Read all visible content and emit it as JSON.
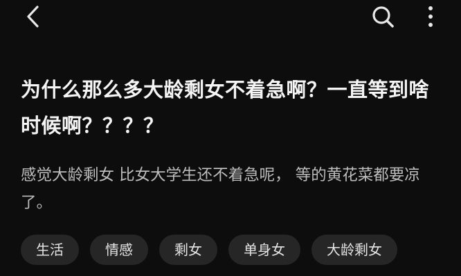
{
  "header": {
    "back_icon": "chevron-left-icon",
    "search_icon": "search-icon",
    "more_icon": "more-vertical-icon"
  },
  "question": {
    "title": "为什么那么多大龄剩女不着急啊？一直等到啥时候啊？？？？",
    "description": "感觉大龄剩女 比女大学生还不着急呢， 等的黄花菜都要凉了。"
  },
  "tags": [
    {
      "label": "生活"
    },
    {
      "label": "情感"
    },
    {
      "label": "剩女"
    },
    {
      "label": "单身女"
    },
    {
      "label": "大龄剩女"
    }
  ],
  "colors": {
    "background": "#0d0d0d",
    "title_text": "#f5f5f5",
    "description_text": "#bdbdbd",
    "tag_background": "#262626"
  }
}
